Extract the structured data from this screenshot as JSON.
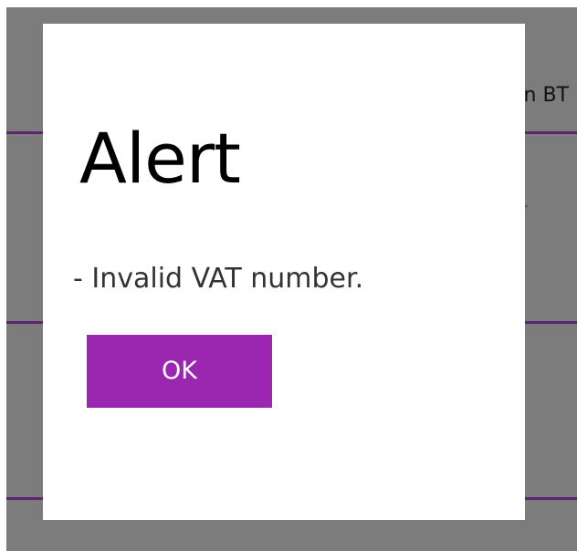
{
  "background": {
    "partial_text": "en BТ",
    "rule_color": "#5b2670",
    "overlay_color": "#7c7c7c"
  },
  "dialog": {
    "title": "Alert",
    "message": "- Invalid VAT number.",
    "ok_label": "OK",
    "button_color": "#9b27b0"
  }
}
